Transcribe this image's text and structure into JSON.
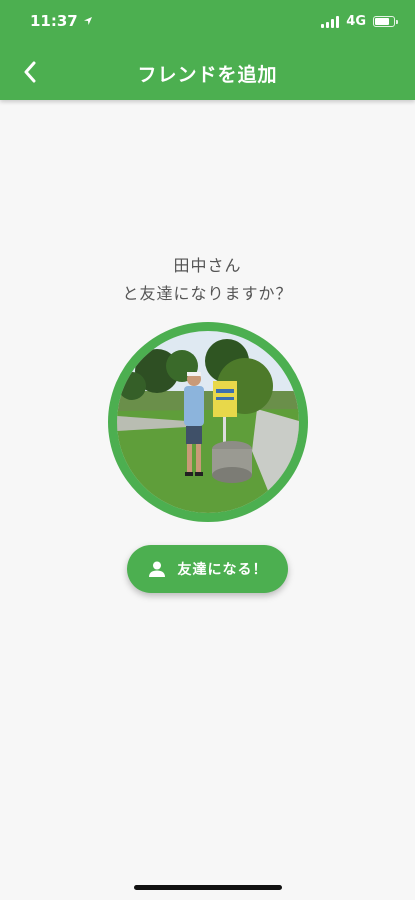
{
  "status": {
    "time": "11:37",
    "network": "4G",
    "battery_level": 0.85
  },
  "nav": {
    "title": "フレンドを追加"
  },
  "prompt": {
    "line1": "田中さん",
    "line2": "と友達になりますか？"
  },
  "action": {
    "label": "友達になる！"
  },
  "colors": {
    "primary": "#4caf50",
    "background": "#f7f7f7",
    "text": "#555555"
  },
  "icons": {
    "back": "chevron-left-icon",
    "location": "location-arrow-icon",
    "action": "person-icon"
  }
}
